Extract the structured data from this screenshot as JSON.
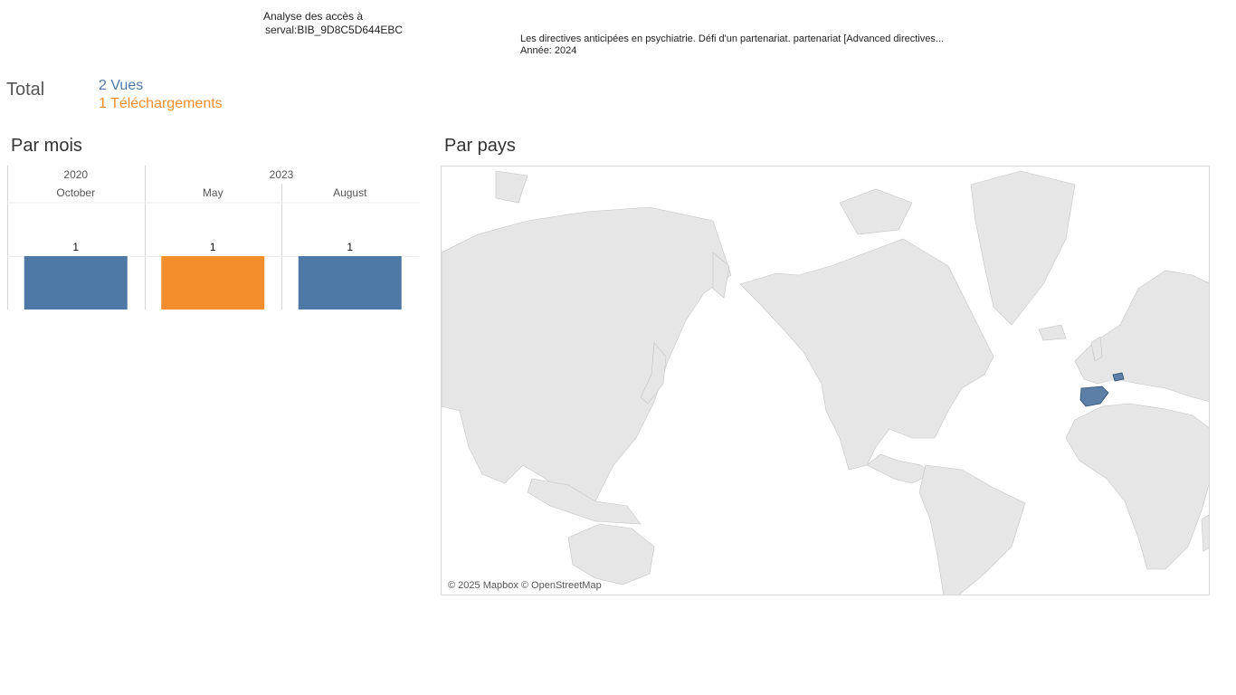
{
  "header": {
    "title_line1": "Analyse des accès à",
    "title_line2": "serval:BIB_9D8C5D644EBC",
    "doc_title": "Les directives anticipées en psychiatrie. Défi d'un partenariat. partenariat [Advanced directives...",
    "doc_year": "Année: 2024"
  },
  "total": {
    "label": "Total",
    "views": "2 Vues",
    "downloads": "1 Téléchargements"
  },
  "sections": {
    "by_month": "Par mois",
    "by_country": "Par pays"
  },
  "colors": {
    "views": "#4e79a7",
    "downloads": "#f28e2b",
    "land": "#e6e6e6",
    "highlight": "#5b7fa6"
  },
  "chart_data": {
    "type": "bar",
    "year_groups": [
      {
        "year": "2020",
        "months": [
          "October"
        ]
      },
      {
        "year": "2023",
        "months": [
          "May",
          "August"
        ]
      }
    ],
    "categories": [
      "October",
      "May",
      "August"
    ],
    "values": [
      1,
      1,
      1
    ],
    "bar_colors": [
      "#4e79a7",
      "#f28e2b",
      "#4e79a7"
    ],
    "data_labels": [
      "1",
      "1",
      "1"
    ],
    "ylim": [
      0,
      1
    ]
  },
  "map": {
    "highlighted_countries": [
      "Spain",
      "Switzerland"
    ],
    "credit": "© 2025 Mapbox © OpenStreetMap"
  }
}
